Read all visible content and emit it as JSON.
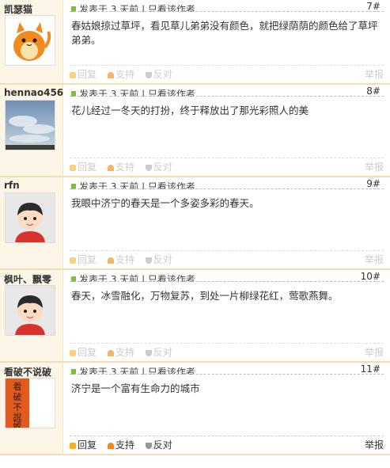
{
  "posts": [
    {
      "username": "凯瑟猫",
      "meta": "发表于 3 天前 | 只看该作者",
      "floor": "7#",
      "content": "春姑娘掠过草坪，看见草儿弟弟没有颜色，就把绿荫荫的颜色给了草坪弟弟。",
      "avatar": "cat-avatar"
    },
    {
      "username": "hennao456",
      "meta": "发表于 3 天前 | 只看该作者",
      "floor": "8#",
      "content": "花儿经过一冬天的打扮，终于释放出了那光彩照人的美",
      "avatar": "sky-clouds-avatar"
    },
    {
      "username": "rfn",
      "meta": "发表于 3 天前 | 只看该作者",
      "floor": "9#",
      "content": "我眼中济宁的春天是一个多姿多彩的春天。",
      "avatar": "cartoon-boy-avatar"
    },
    {
      "username": "枫叶、飘零",
      "meta": "发表于 3 天前 | 只看该作者",
      "floor": "10#",
      "content": "春天，冰雪融化，万物复苏，到处一片柳绿花红，莺歌燕舞。",
      "avatar": "cartoon-boy-avatar"
    },
    {
      "username": "看破不说破",
      "meta": "发表于 3 天前 | 只看该作者",
      "floor": "11#",
      "content": "济宁是一个富有生命力的城市",
      "avatar": "calligraphy-avatar",
      "avatar_text": "看破不说破"
    }
  ],
  "actions": {
    "reply": "回复",
    "support": "支持",
    "oppose": "反对",
    "report": "举报"
  }
}
